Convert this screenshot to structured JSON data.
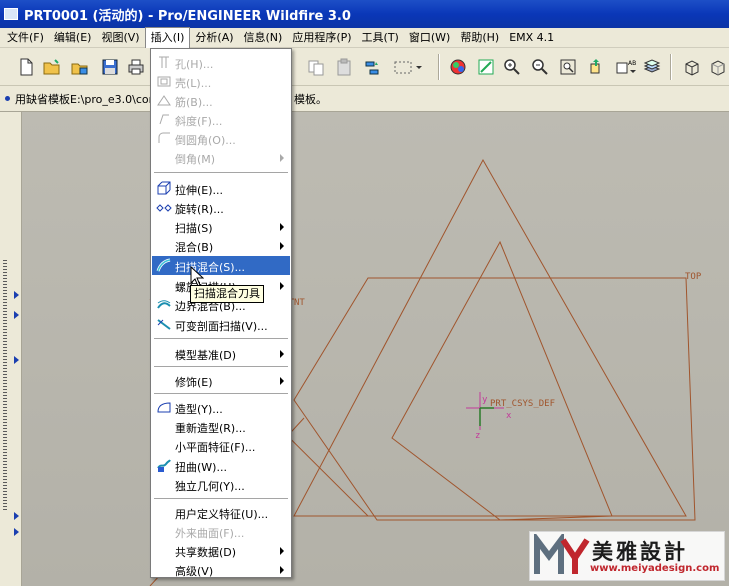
{
  "window": {
    "title": "PRT0001 (活动的) - Pro/ENGINEER Wildfire 3.0"
  },
  "menubar": {
    "items": [
      {
        "label": "文件(F)"
      },
      {
        "label": "编辑(E)"
      },
      {
        "label": "视图(V)"
      },
      {
        "label": "插入(I)",
        "active": true
      },
      {
        "label": "分析(A)"
      },
      {
        "label": "信息(N)"
      },
      {
        "label": "应用程序(P)"
      },
      {
        "label": "工具(T)"
      },
      {
        "label": "窗口(W)"
      },
      {
        "label": "帮助(H)"
      },
      {
        "label": "EMX 4.1"
      }
    ]
  },
  "message_bar": {
    "text": "用缺省模板E:\\pro_e3.0\\cor",
    "text_tail": "模板。"
  },
  "insert_menu": {
    "items": [
      {
        "label": "孔(H)...",
        "disabled": true,
        "icon": "hole-icon"
      },
      {
        "label": "壳(L)...",
        "disabled": true,
        "icon": "shell-icon"
      },
      {
        "label": "筋(B)...",
        "disabled": true,
        "icon": "rib-icon"
      },
      {
        "label": "斜度(F)...",
        "disabled": true,
        "icon": "draft-icon"
      },
      {
        "label": "倒圆角(O)...",
        "disabled": true,
        "icon": "round-icon"
      },
      {
        "label": "倒角(M)",
        "disabled": true,
        "submenu": true
      },
      {
        "label": "拉伸(E)...",
        "icon": "extrude-icon"
      },
      {
        "label": "旋转(R)...",
        "icon": "revolve-icon"
      },
      {
        "label": "扫描(S)",
        "submenu": true
      },
      {
        "label": "混合(B)",
        "submenu": true
      },
      {
        "label": "扫描混合(S)...",
        "icon": "swept-blend-icon",
        "highlight": true
      },
      {
        "label": "螺旋扫描(H)",
        "submenu": true
      },
      {
        "label": "边界混合(B)...",
        "icon": "boundary-blend-icon"
      },
      {
        "label": "可变剖面扫描(V)...",
        "icon": "variable-section-sweep-icon"
      },
      {
        "label": "模型基准(D)",
        "submenu": true
      },
      {
        "label": "修饰(E)",
        "submenu": true
      },
      {
        "label": "造型(Y)...",
        "icon": "style-icon"
      },
      {
        "label": "重新造型(R)..."
      },
      {
        "label": "小平面特征(F)..."
      },
      {
        "label": "扭曲(W)...",
        "icon": "warp-icon"
      },
      {
        "label": "独立几何(Y)..."
      },
      {
        "label": "用户定义特征(U)..."
      },
      {
        "label": "外来曲面(F)...",
        "disabled": true
      },
      {
        "label": "共享数据(D)",
        "submenu": true
      },
      {
        "label": "高级(V)",
        "submenu": true
      }
    ]
  },
  "tooltip": {
    "text": "扫描混合刀具"
  },
  "graphics": {
    "labels": {
      "top": "TOP",
      "front": "NT",
      "csys": "PRT_CSYS_DEF",
      "x_axis": "x",
      "y_axis": "y",
      "z_axis": "z"
    },
    "colors": {
      "datum": "#a0552d",
      "csys": "#c23a9a",
      "background": "#b9b7ae"
    }
  },
  "watermark": {
    "title": "美雅設計",
    "url": "www.meiyadesign.com"
  }
}
